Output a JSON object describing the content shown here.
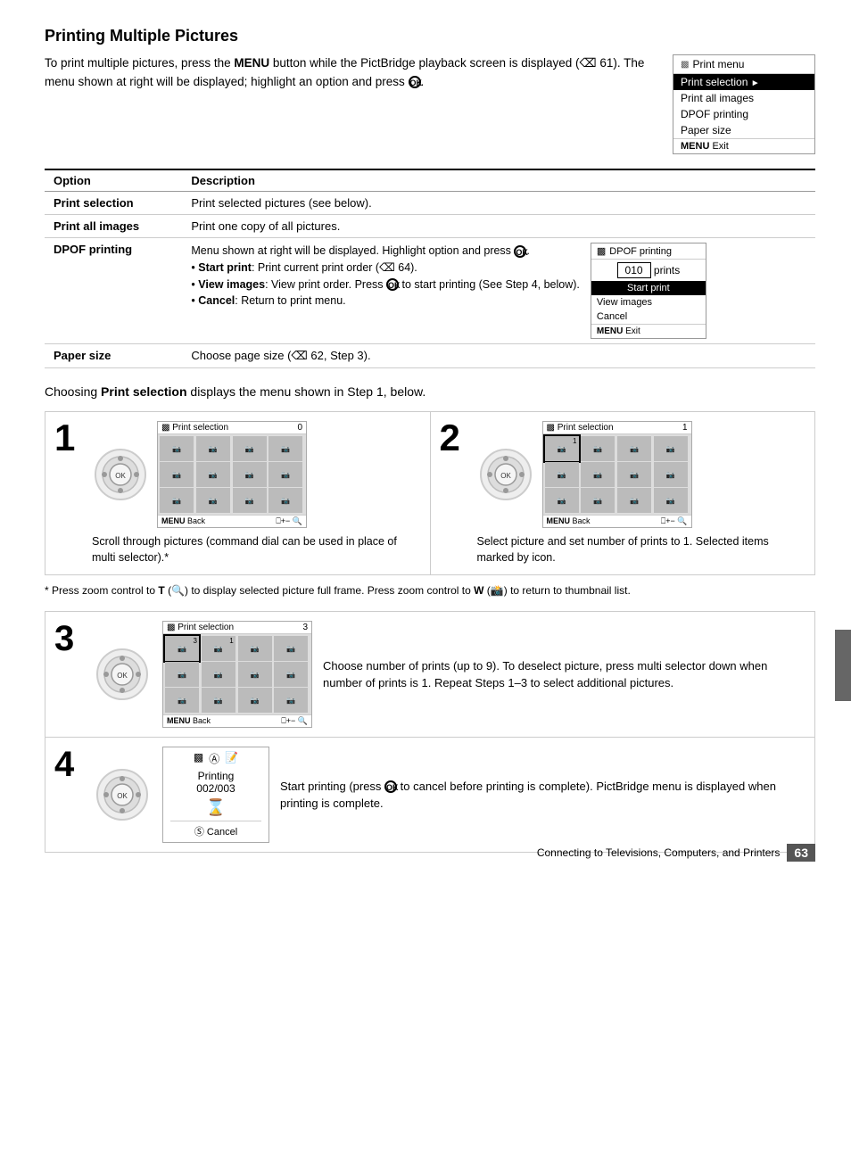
{
  "page": {
    "title": "Printing Multiple Pictures",
    "intro": "To print multiple pictures, press the MENU button while the PictBridge playback screen is displayed (Ø 61). The menu shown at right will be displayed; highlight an option and press Ⓢ.",
    "print_menu": {
      "header": "Print menu",
      "items": [
        {
          "label": "Print selection",
          "selected": true
        },
        {
          "label": "Print all images"
        },
        {
          "label": "DPOF printing"
        },
        {
          "label": "Paper size"
        }
      ],
      "footer": "MENU Exit"
    },
    "table": {
      "col1": "Option",
      "col2": "Description",
      "rows": [
        {
          "option": "Print selection",
          "description": "Print selected pictures (see below)."
        },
        {
          "option": "Print all images",
          "description": "Print one copy of all pictures."
        },
        {
          "option": "DPOF printing",
          "description_parts": [
            "Menu shown at right will be displayed. Highlight option and press Ⓢ.",
            "• Start print: Print current print order (Ø 64).",
            "• View images: View print order. Press Ⓢ to start printing (See Step 4, below).",
            "• Cancel: Return to print menu."
          ],
          "dpof_box": {
            "header": "DPOF printing",
            "prints_label": "010 prints",
            "items": [
              {
                "label": "Start print",
                "selected": true
              },
              {
                "label": "View images"
              },
              {
                "label": "Cancel"
              }
            ],
            "footer": "MENU Exit"
          }
        },
        {
          "option": "Paper size",
          "description": "Choose page size (Ø 62, Step 3)."
        }
      ]
    },
    "print_selection_intro": "Choosing Print selection displays the menu shown in Step 1, below.",
    "steps": [
      {
        "num": "1",
        "screen_title": "Print selection",
        "screen_count": "0",
        "text": "Scroll through pictures (command dial can be used in place of multi selector).*"
      },
      {
        "num": "2",
        "screen_title": "Print selection",
        "screen_count": "1",
        "text": "Select picture and set number of prints to 1. Selected items marked by icon."
      },
      {
        "num": "3",
        "screen_title": "Print selection",
        "screen_count": "3",
        "text": "Choose number of prints (up to 9). To deselect picture, press multi selector down when number of prints is 1. Repeat Steps 1–3 to select additional pictures."
      },
      {
        "num": "4",
        "printing": {
          "icons": "ℹⓘ≡",
          "label": "Printing",
          "count": "002/003",
          "cancel_label": "ⓈK Cancel"
        },
        "text": "Start printing (press Ⓢ to cancel before printing is complete). PictBridge menu is displayed when printing is complete."
      }
    ],
    "footnote": "* Press zoom control to T (🔍) to display selected picture full frame. Press zoom control to W (📷) to return to thumbnail list.",
    "footer": {
      "text": "Connecting to Televisions, Computers, and Printers",
      "page_num": "63"
    }
  }
}
